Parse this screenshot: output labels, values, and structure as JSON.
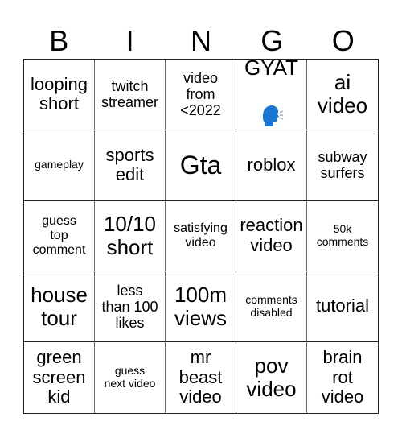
{
  "header": {
    "letters": [
      "B",
      "I",
      "N",
      "G",
      "O"
    ]
  },
  "board": {
    "rows": [
      [
        {
          "text": "looping\nshort"
        },
        {
          "text": "twitch\nstreamer"
        },
        {
          "text": "video\nfrom\n<2022"
        },
        {
          "text": "GYAT",
          "emoji": "🗣",
          "emoji_name": "speaking-head-icon",
          "emoji_color": "#1976d2"
        },
        {
          "text": "ai\nvideo"
        }
      ],
      [
        {
          "text": "gameplay"
        },
        {
          "text": "sports\nedit"
        },
        {
          "text": "Gta"
        },
        {
          "text": "roblox"
        },
        {
          "text": "subway\nsurfers"
        }
      ],
      [
        {
          "text": "guess\ntop\ncomment"
        },
        {
          "text": "10/10\nshort"
        },
        {
          "text": "satisfying\nvideo"
        },
        {
          "text": "reaction\nvideo"
        },
        {
          "text": "50k\ncomments"
        }
      ],
      [
        {
          "text": "house\ntour"
        },
        {
          "text": "less\nthan 100\nlikes"
        },
        {
          "text": "100m\nviews"
        },
        {
          "text": "comments\ndisabled"
        },
        {
          "text": "tutorial"
        }
      ],
      [
        {
          "text": "green\nscreen\nkid"
        },
        {
          "text": "guess\nnext video"
        },
        {
          "text": "mr\nbeast\nvideo"
        },
        {
          "text": "pov\nvideo"
        },
        {
          "text": "brain\nrot\nvideo"
        }
      ]
    ]
  }
}
